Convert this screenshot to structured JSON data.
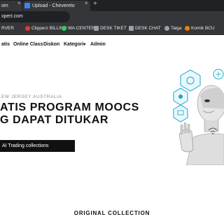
{
  "browser": {
    "tabs": [
      {
        "label": "om",
        "state": "inactive"
      },
      {
        "label": "Upload - Chevereto",
        "state": "active"
      }
    ],
    "new_tab_symbol": "+",
    "close_symbol": "×",
    "url": "xpert.com",
    "bookmarks": [
      {
        "label": "RVER",
        "icon": "bookmark-icon",
        "color": "#9aa0a6"
      },
      {
        "label": "Clipperz BILLING",
        "icon": "clipperz-icon",
        "color": "#e53935"
      },
      {
        "label": "WA CENTER",
        "icon": "whatsapp-icon",
        "color": "#25d366"
      },
      {
        "label": "DESK TIKET",
        "icon": "desk-icon",
        "color": "#9aa0a6"
      },
      {
        "label": "DESK CHAT",
        "icon": "desk-icon",
        "color": "#9aa0a6"
      },
      {
        "label": "Taiga",
        "icon": "taiga-icon",
        "color": "#9aa0a6"
      },
      {
        "label": "Komik BCU",
        "icon": "komik-icon",
        "color": "#f57c00"
      }
    ]
  },
  "nav": {
    "items": [
      "atis",
      "Online Class",
      "Diskon",
      "Kategori",
      "Admin"
    ],
    "dropdown_symbol": "▾"
  },
  "hero": {
    "subtitle": "EW JERSEY AUSTRALIA",
    "title_line1": "ATIS PROGRAM MOOCS",
    "title_line2": "G DAPAT DITUKAR",
    "button_label": "AI Trading collections"
  },
  "section": {
    "title": "ORIGINAL COLLECTION"
  },
  "colors": {
    "browser_dark": "#202124",
    "browser_bar": "#35363a",
    "page_text": "#111111",
    "robot_accent": "#1aa7c9"
  }
}
